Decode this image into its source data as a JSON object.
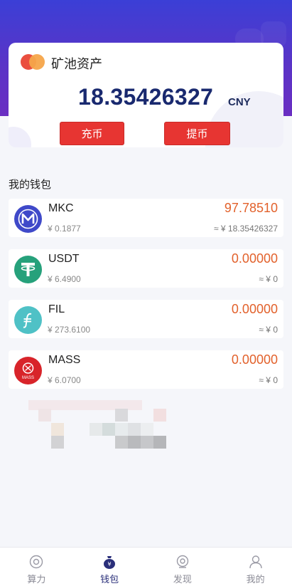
{
  "asset_card": {
    "title": "矿池资产",
    "amount": "18.35426327",
    "unit": "CNY",
    "deposit_label": "充币",
    "withdraw_label": "提币"
  },
  "wallet": {
    "section_title": "我的钱包",
    "items": [
      {
        "name": "MKC",
        "price": "¥ 0.1877",
        "quantity": "97.78510",
        "value": "≈ ¥ 18.35426327",
        "icon": "mkc-coin-icon",
        "color": "#3f49c9"
      },
      {
        "name": "USDT",
        "price": "¥ 6.4900",
        "quantity": "0.00000",
        "value": "≈ ¥ 0",
        "icon": "usdt-coin-icon",
        "color": "#26a17b"
      },
      {
        "name": "FIL",
        "price": "¥ 273.6100",
        "quantity": "0.00000",
        "value": "≈ ¥ 0",
        "icon": "fil-coin-icon",
        "color": "#4fc1c6"
      },
      {
        "name": "MASS",
        "price": "¥ 6.0700",
        "quantity": "0.00000",
        "value": "≈ ¥ 0",
        "icon": "mass-coin-icon",
        "color": "#d8242a"
      }
    ]
  },
  "tabs": [
    {
      "label": "算力",
      "icon": "compute-icon",
      "active": false
    },
    {
      "label": "钱包",
      "icon": "wallet-icon",
      "active": true
    },
    {
      "label": "发现",
      "icon": "discover-icon",
      "active": false
    },
    {
      "label": "我的",
      "icon": "profile-icon",
      "active": false
    }
  ],
  "colors": {
    "header_gradient_top": "#3b3fd6",
    "header_gradient_bottom": "#6a2ec2",
    "amount_color": "#19296f",
    "button_red": "#e73532",
    "quantity_orange": "#e2612b",
    "active_tab": "#2a2f7a"
  }
}
